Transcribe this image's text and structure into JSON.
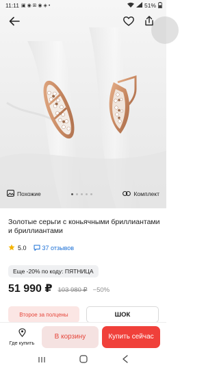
{
  "status": {
    "time": "11:11",
    "battery": "51%"
  },
  "hero": {
    "similar_label": "Похожие",
    "set_label": "Комплект",
    "slides": 5,
    "active_slide": 1
  },
  "product": {
    "title": "Золотые серьги с коньячными бриллиантами и бриллиантами",
    "rating": "5.0",
    "reviews": "37 отзывов"
  },
  "promo": {
    "text": "Еще -20% по коду: ПЯТНИЦА"
  },
  "price": {
    "current": "51 990 ₽",
    "old": "103 980 ₽",
    "discount": "−50%"
  },
  "options": {
    "card1": "Второе за полцены",
    "card2": "ШОК"
  },
  "bottom_bar": {
    "where_buy": "Где купить",
    "add_to_cart": "В корзину",
    "buy_now": "Купить сейчас"
  },
  "colors": {
    "accent": "#f0403a",
    "accent_soft": "#f5e2e1",
    "link": "#1a6fd6",
    "star": "#f5b400"
  },
  "icons": {
    "back": "arrow-left-icon",
    "favorite": "heart-icon",
    "share": "share-icon",
    "similar": "image-icon",
    "set": "link-icon",
    "where_buy": "location-pin-icon"
  }
}
